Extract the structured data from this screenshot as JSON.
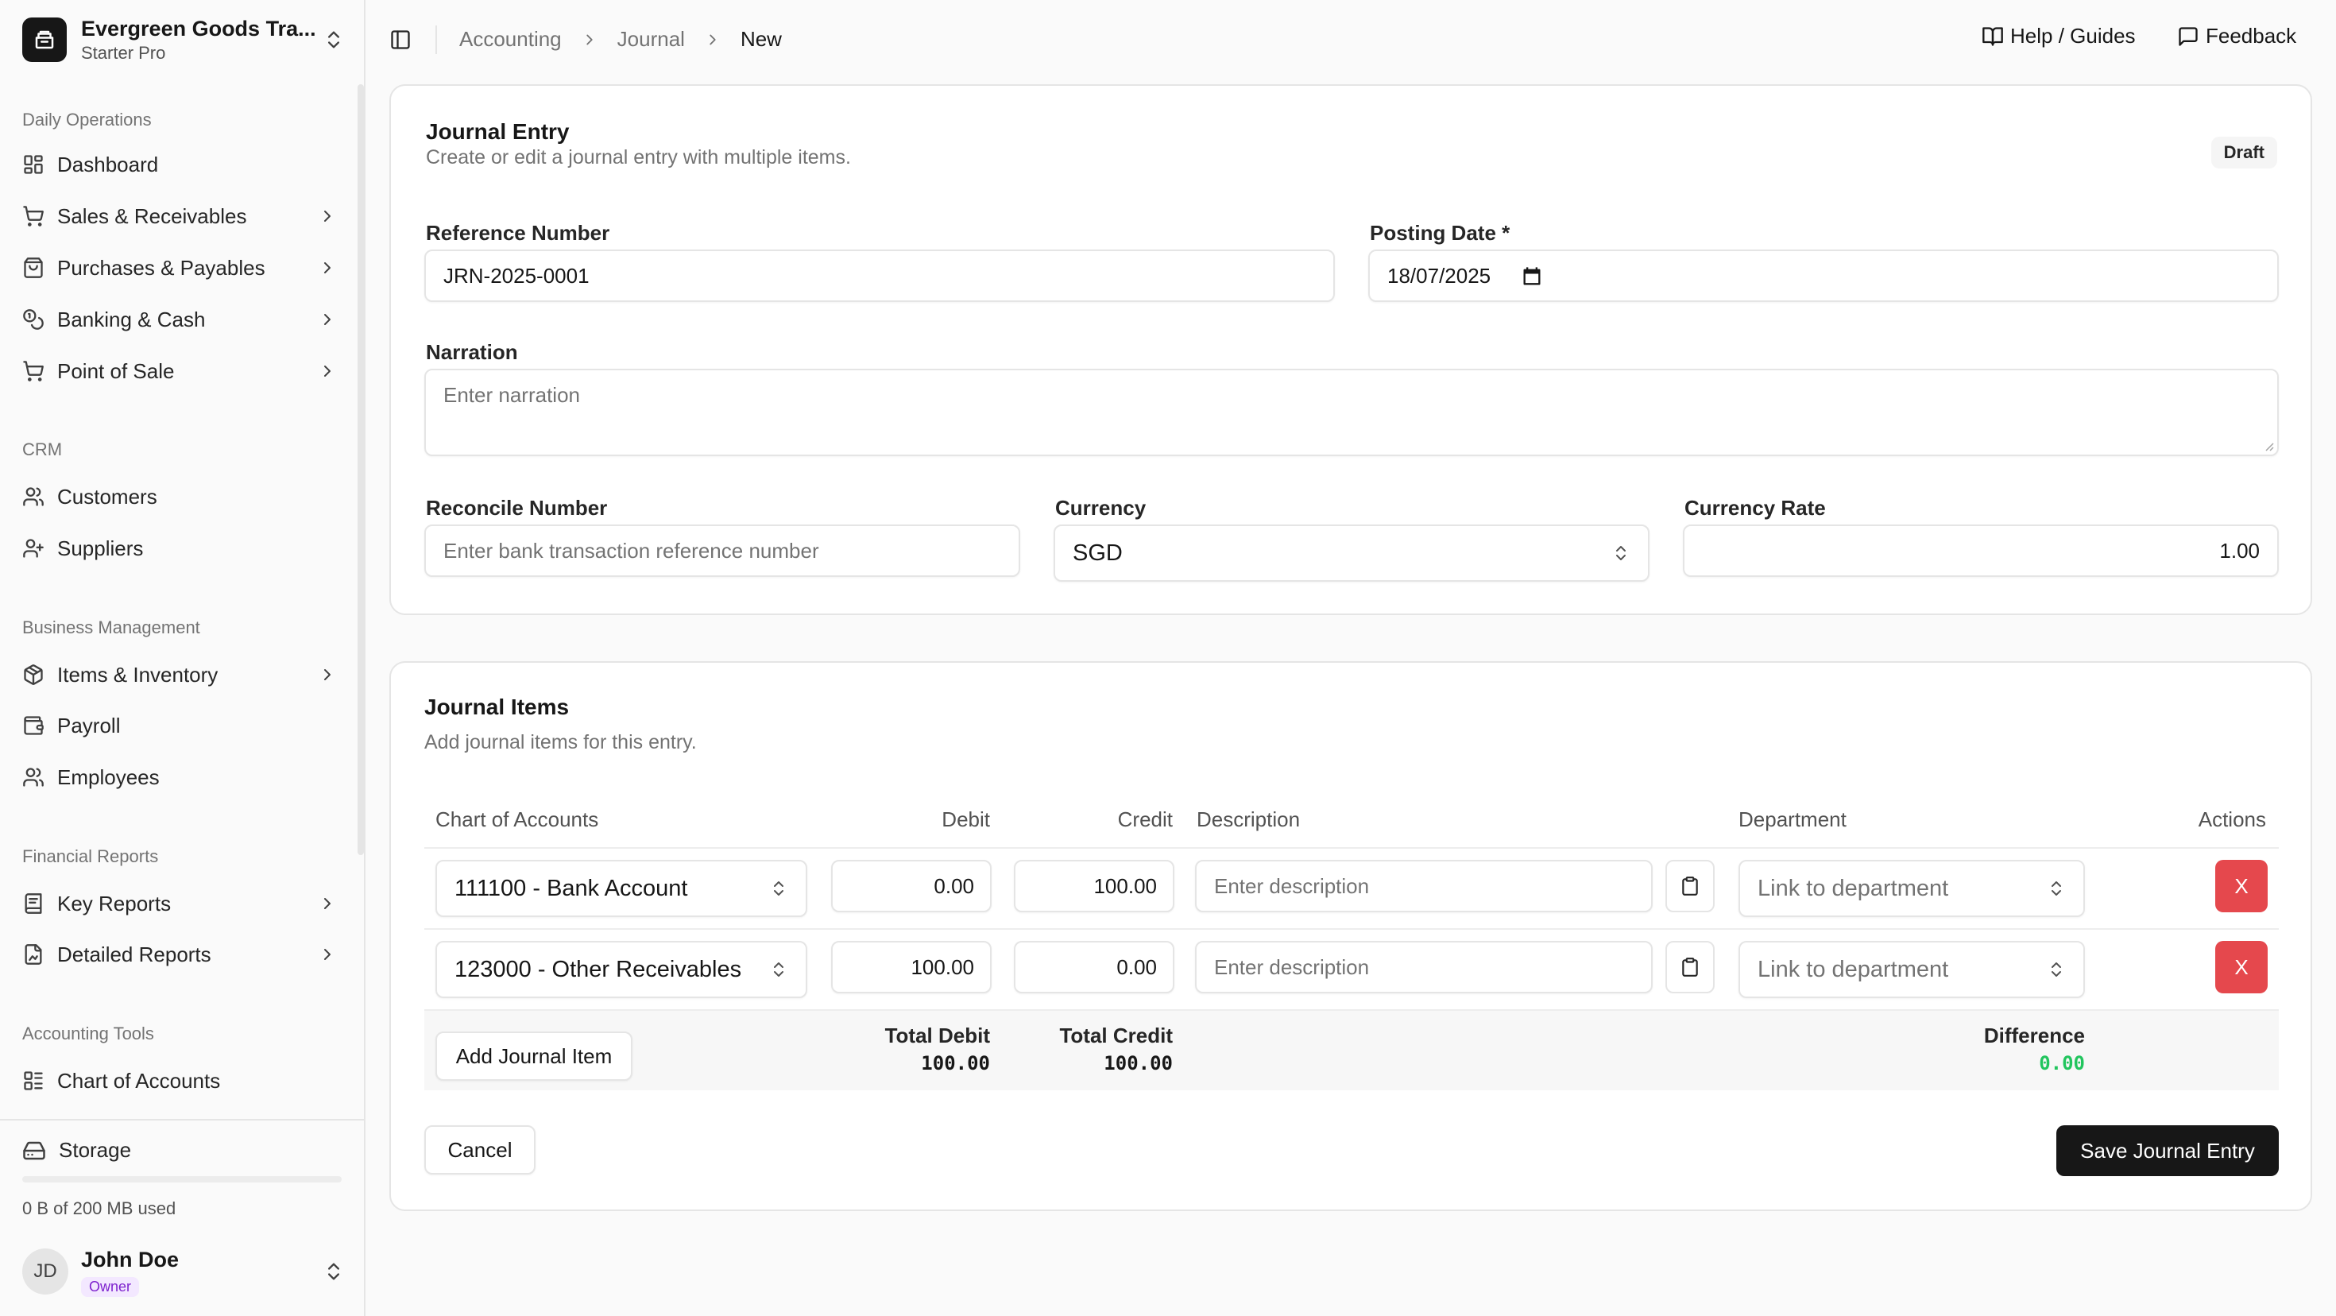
{
  "org": {
    "name": "Evergreen Goods Tra...",
    "plan": "Starter Pro"
  },
  "nav": {
    "groups": [
      {
        "label": "Daily Operations"
      },
      {
        "label": "CRM"
      },
      {
        "label": "Business Management"
      },
      {
        "label": "Financial Reports"
      },
      {
        "label": "Accounting Tools"
      }
    ],
    "items": [
      {
        "label": "Dashboard",
        "icon": "dashboard-icon"
      },
      {
        "label": "Sales & Receivables",
        "icon": "cart-icon"
      },
      {
        "label": "Purchases & Payables",
        "icon": "bag-icon"
      },
      {
        "label": "Banking & Cash",
        "icon": "coins-icon"
      },
      {
        "label": "Point of Sale",
        "icon": "cart-icon"
      },
      {
        "label": "Customers",
        "icon": "users-icon"
      },
      {
        "label": "Suppliers",
        "icon": "user-icon"
      },
      {
        "label": "Items & Inventory",
        "icon": "package-icon"
      },
      {
        "label": "Payroll",
        "icon": "wallet-icon"
      },
      {
        "label": "Employees",
        "icon": "users-icon"
      },
      {
        "label": "Key Reports",
        "icon": "book-icon"
      },
      {
        "label": "Detailed Reports",
        "icon": "file-chart-icon"
      },
      {
        "label": "Chart of Accounts",
        "icon": "list-icon"
      }
    ]
  },
  "storage": {
    "label": "Storage",
    "usage": "0 B of 200 MB used",
    "used_fraction": 0.0
  },
  "user": {
    "initials": "JD",
    "name": "John Doe",
    "role": "Owner"
  },
  "breadcrumb": {
    "items": [
      "Accounting",
      "Journal",
      "New"
    ]
  },
  "header_links": {
    "help": "Help / Guides",
    "feedback": "Feedback"
  },
  "entry": {
    "title": "Journal Entry",
    "subtitle": "Create or edit a journal entry with multiple items.",
    "status": "Draft",
    "reference": {
      "label": "Reference Number",
      "value": "JRN-2025-0001"
    },
    "posting_date": {
      "label": "Posting Date *",
      "value": "18/07/2025"
    },
    "narration": {
      "label": "Narration",
      "placeholder": "Enter narration"
    },
    "reconcile": {
      "label": "Reconcile Number",
      "placeholder": "Enter bank transaction reference number"
    },
    "currency": {
      "label": "Currency",
      "value": "SGD"
    },
    "currency_rate": {
      "label": "Currency Rate",
      "value": "1.00"
    }
  },
  "items_section": {
    "title": "Journal Items",
    "subtitle": "Add journal items for this entry.",
    "columns": {
      "account": "Chart of Accounts",
      "debit": "Debit",
      "credit": "Credit",
      "description": "Description",
      "department": "Department",
      "actions": "Actions"
    },
    "rows": [
      {
        "account": "111100 - Bank Account",
        "debit": "0.00",
        "credit": "100.00",
        "description_placeholder": "Enter description",
        "department_placeholder": "Link to department",
        "delete_label": "X"
      },
      {
        "account": "123000 - Other Receivables",
        "debit": "100.00",
        "credit": "0.00",
        "description_placeholder": "Enter description",
        "department_placeholder": "Link to department",
        "delete_label": "X"
      }
    ],
    "add_label": "Add Journal Item",
    "totals": {
      "debit_label": "Total Debit",
      "debit_value": "100.00",
      "credit_label": "Total Credit",
      "credit_value": "100.00",
      "difference_label": "Difference",
      "difference_value": "0.00"
    }
  },
  "actions": {
    "cancel": "Cancel",
    "save": "Save Journal Entry"
  },
  "colors": {
    "accent": "#171717",
    "danger": "#e5484d",
    "success": "#22c55e",
    "role_badge": "#7e22ce"
  }
}
